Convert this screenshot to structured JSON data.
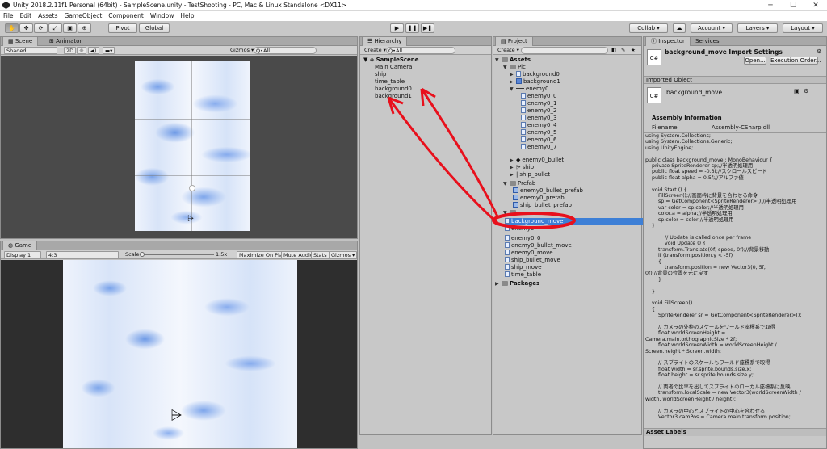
{
  "window": {
    "title": "Unity 2018.2.11f1 Personal (64bit) - SampleScene.unity - TestShooting - PC, Mac & Linux Standalone <DX11>",
    "min": "─",
    "max": "☐",
    "close": "✕"
  },
  "menu": [
    "File",
    "Edit",
    "Assets",
    "GameObject",
    "Component",
    "Window",
    "Help"
  ],
  "toolbar": {
    "pivot": "Pivot",
    "global": "Global",
    "play": "▶",
    "pause": "❚❚",
    "step": "▶❚",
    "collab": "Collab ▾",
    "account": "Account ▾",
    "layers": "Layers ▾",
    "layout": "Layout ▾"
  },
  "scene": {
    "tab": "Scene",
    "tab2": "Animator",
    "shading": "Shaded",
    "mode2d": "2D",
    "gizmos": "Gizmos ▾",
    "search": "Q•All"
  },
  "game": {
    "tab": "Game",
    "display": "Display 1",
    "aspect": "4:3",
    "scale_label": "Scale",
    "scale_value": "1.5x",
    "maximize": "Maximize On Play",
    "mute": "Mute Audio",
    "stats": "Stats",
    "gizmos": "Gizmos ▾"
  },
  "hierarchy": {
    "tab": "Hierarchy",
    "create": "Create ▾",
    "search": "Q•All",
    "scene": "SampleScene",
    "items": [
      "Main Camera",
      "ship",
      "time_table",
      "background0",
      "background1"
    ]
  },
  "project": {
    "tab": "Project",
    "create": "Create ▾",
    "assets": "Assets",
    "pic": "Pic",
    "pic_items": [
      "background0",
      "background1"
    ],
    "enemy0": "enemy0",
    "enemy_frames": [
      "enemy0_0",
      "enemy0_1",
      "enemy0_2",
      "enemy0_3",
      "enemy0_4",
      "enemy0_5",
      "enemy0_6",
      "enemy0_7"
    ],
    "pic_items2": [
      "enemy0_bullet",
      "ship",
      "ship_bullet"
    ],
    "prefab": "Prefab",
    "prefab_items": [
      "enemy0_bullet_prefab",
      "enemy0_prefab",
      "ship_bullet_prefab"
    ],
    "selected": "background_move",
    "partial": "enemy0",
    "scripts": [
      "enemy0_0",
      "enemy0_bullet_move",
      "enemy0_move",
      "ship_bullet_move",
      "ship_move",
      "time_table"
    ],
    "packages": "Packages"
  },
  "inspector": {
    "tab": "Inspector",
    "tab2": "Services",
    "title": "background_move Import Settings",
    "open": "Open...",
    "exec": "Execution Order...",
    "imported": "Imported Object",
    "script_name": "background_move",
    "assembly_header": "Assembly Information",
    "filename_label": "Filename",
    "filename_value": "Assembly-CSharp.dll",
    "code": "using System.Collections;\nusing System.Collections.Generic;\nusing UnityEngine;\n\npublic class background_move : MonoBehaviour {\n    private SpriteRenderer sp;//半透明処理用\n    public float speed = -0.3f;//スクロールスピード\n    public float alpha = 0.5f;//アルファ値\n\n    void Start () {\n        FillScreen();//画面枠に背景を合わせる命令\n        sp = GetComponent<SpriteRenderer>();//半透明処理用\n        var color = sp.color;//半透明処理用\n        color.a = alpha;//半透明処理用\n        sp.color = color;//半透明処理用\n    }\n\n            // Update is called once per frame\n            void Update () {\n        transform.Translate(0f, speed, 0f);//背景移動\n        if (transform.position.y < -5f)\n        {\n            transform.position = new Vector3(0, 5f,\n0f);//背景の位置を元に戻す\n        }\n\n    }\n\n    void FillScreen()\n    {\n        SpriteRenderer sr = GetComponent<SpriteRenderer>();\n\n        // カメラの外枠のスケールをワールド座標系で取得\n        float worldScreenHeight =\nCamera.main.orthographicSize * 2f;\n        float worldScreenWidth = worldScreenHeight /\nScreen.height * Screen.width;\n\n        // スプライトのスケールもワールド座標系で取得\n        float width = sr.sprite.bounds.size.x;\n        float height = sr.sprite.bounds.size.y;\n\n        // 両者の比率を出してスプライトのローカル座標系に反映\n        transform.localScale = new Vector3(worldScreenWidth /\nwidth, worldScreenHeight / height);\n\n        // カメラの中心とスプライトの中心を合わせる\n        Vector3 camPos = Camera.main.transform.position;",
    "asset_labels": "Asset Labels"
  },
  "colors": {
    "selection": "#3d7fd6",
    "annotation": "#e8101c"
  }
}
